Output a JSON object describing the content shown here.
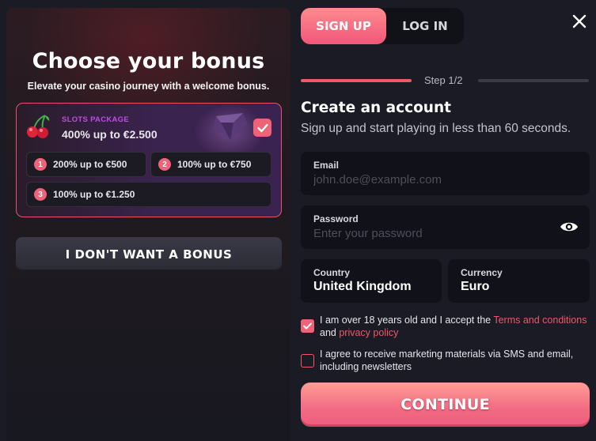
{
  "bonus_panel": {
    "title": "Choose your bonus",
    "subtitle": "Elevate your casino journey with a welcome bonus.",
    "package": {
      "label": "SLOTS PACKAGE",
      "value": "400% up to €2.500",
      "selected": true,
      "icon": "cherry-icon"
    },
    "options": [
      {
        "number": "1",
        "label": "200% up to €500"
      },
      {
        "number": "2",
        "label": "100% up to €750"
      },
      {
        "number": "3",
        "label": "100% up to €1.250"
      }
    ],
    "no_bonus_label": "I DON'T WANT A BONUS"
  },
  "tabs": [
    {
      "label": "SIGN UP",
      "active": true
    },
    {
      "label": "LOG IN",
      "active": false
    }
  ],
  "step": {
    "text": "Step 1/2",
    "current": 1,
    "total": 2
  },
  "form": {
    "title": "Create an account",
    "subtitle": "Sign up and start playing in less than 60 seconds.",
    "email": {
      "label": "Email",
      "placeholder": "john.doe@example.com"
    },
    "password": {
      "label": "Password",
      "placeholder": "Enter your password"
    },
    "country": {
      "label": "Country",
      "value": "United Kingdom"
    },
    "currency": {
      "label": "Currency",
      "value": "Euro"
    },
    "age_consent": {
      "checked": true,
      "text_before": "I am over 18 years old and I accept the ",
      "terms_link": "Terms and conditions",
      "text_and": "and ",
      "privacy_link": "privacy policy"
    },
    "marketing_consent": {
      "checked": false,
      "line1": "I agree to receive marketing materials via SMS and email,",
      "line2": "including newsletters"
    },
    "continue_label": "CONTINUE"
  },
  "colors": {
    "accent": "#f06277",
    "background": "#1a1b24",
    "field": "#11111a",
    "package_label": "#c04ce0"
  }
}
